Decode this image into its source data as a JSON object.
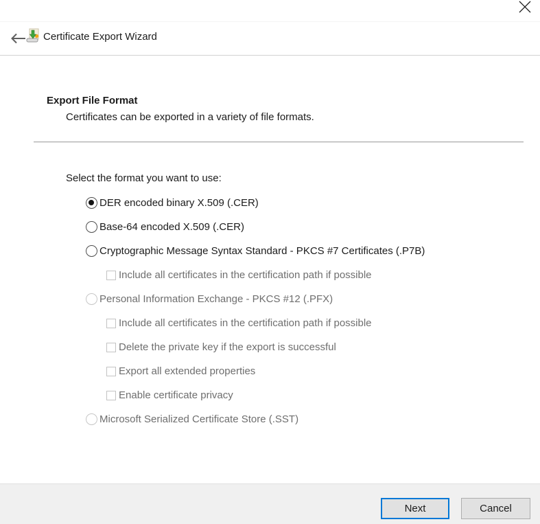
{
  "window": {
    "close_glyph": "close"
  },
  "header": {
    "title": "Certificate Export Wizard"
  },
  "section": {
    "heading": "Export File Format",
    "description": "Certificates can be exported in a variety of file formats."
  },
  "content": {
    "prompt": "Select the format you want to use:",
    "options": [
      {
        "type": "radio",
        "label": "DER encoded binary X.509 (.CER)",
        "selected": true,
        "enabled": true,
        "indent": 0
      },
      {
        "type": "radio",
        "label": "Base-64 encoded X.509 (.CER)",
        "selected": false,
        "enabled": true,
        "indent": 0
      },
      {
        "type": "radio",
        "label": "Cryptographic Message Syntax Standard - PKCS #7 Certificates (.P7B)",
        "selected": false,
        "enabled": true,
        "indent": 0
      },
      {
        "type": "checkbox",
        "label": "Include all certificates in the certification path if possible",
        "checked": false,
        "enabled": false,
        "indent": 1
      },
      {
        "type": "radio",
        "label": "Personal Information Exchange - PKCS #12 (.PFX)",
        "selected": false,
        "enabled": false,
        "indent": 0
      },
      {
        "type": "checkbox",
        "label": "Include all certificates in the certification path if possible",
        "checked": false,
        "enabled": false,
        "indent": 1
      },
      {
        "type": "checkbox",
        "label": "Delete the private key if the export is successful",
        "checked": false,
        "enabled": false,
        "indent": 1
      },
      {
        "type": "checkbox",
        "label": "Export all extended properties",
        "checked": false,
        "enabled": false,
        "indent": 1
      },
      {
        "type": "checkbox",
        "label": "Enable certificate privacy",
        "checked": false,
        "enabled": false,
        "indent": 1
      },
      {
        "type": "radio",
        "label": "Microsoft Serialized Certificate Store (.SST)",
        "selected": false,
        "enabled": false,
        "indent": 0
      }
    ]
  },
  "footer": {
    "next_label": "Next",
    "cancel_label": "Cancel"
  },
  "colors": {
    "accent_blue": "#0078d7",
    "footer_bg": "#f0f0f0",
    "button_bg": "#e1e1e1",
    "disabled_text": "#6e6e6e",
    "text": "#1b1b1b"
  }
}
